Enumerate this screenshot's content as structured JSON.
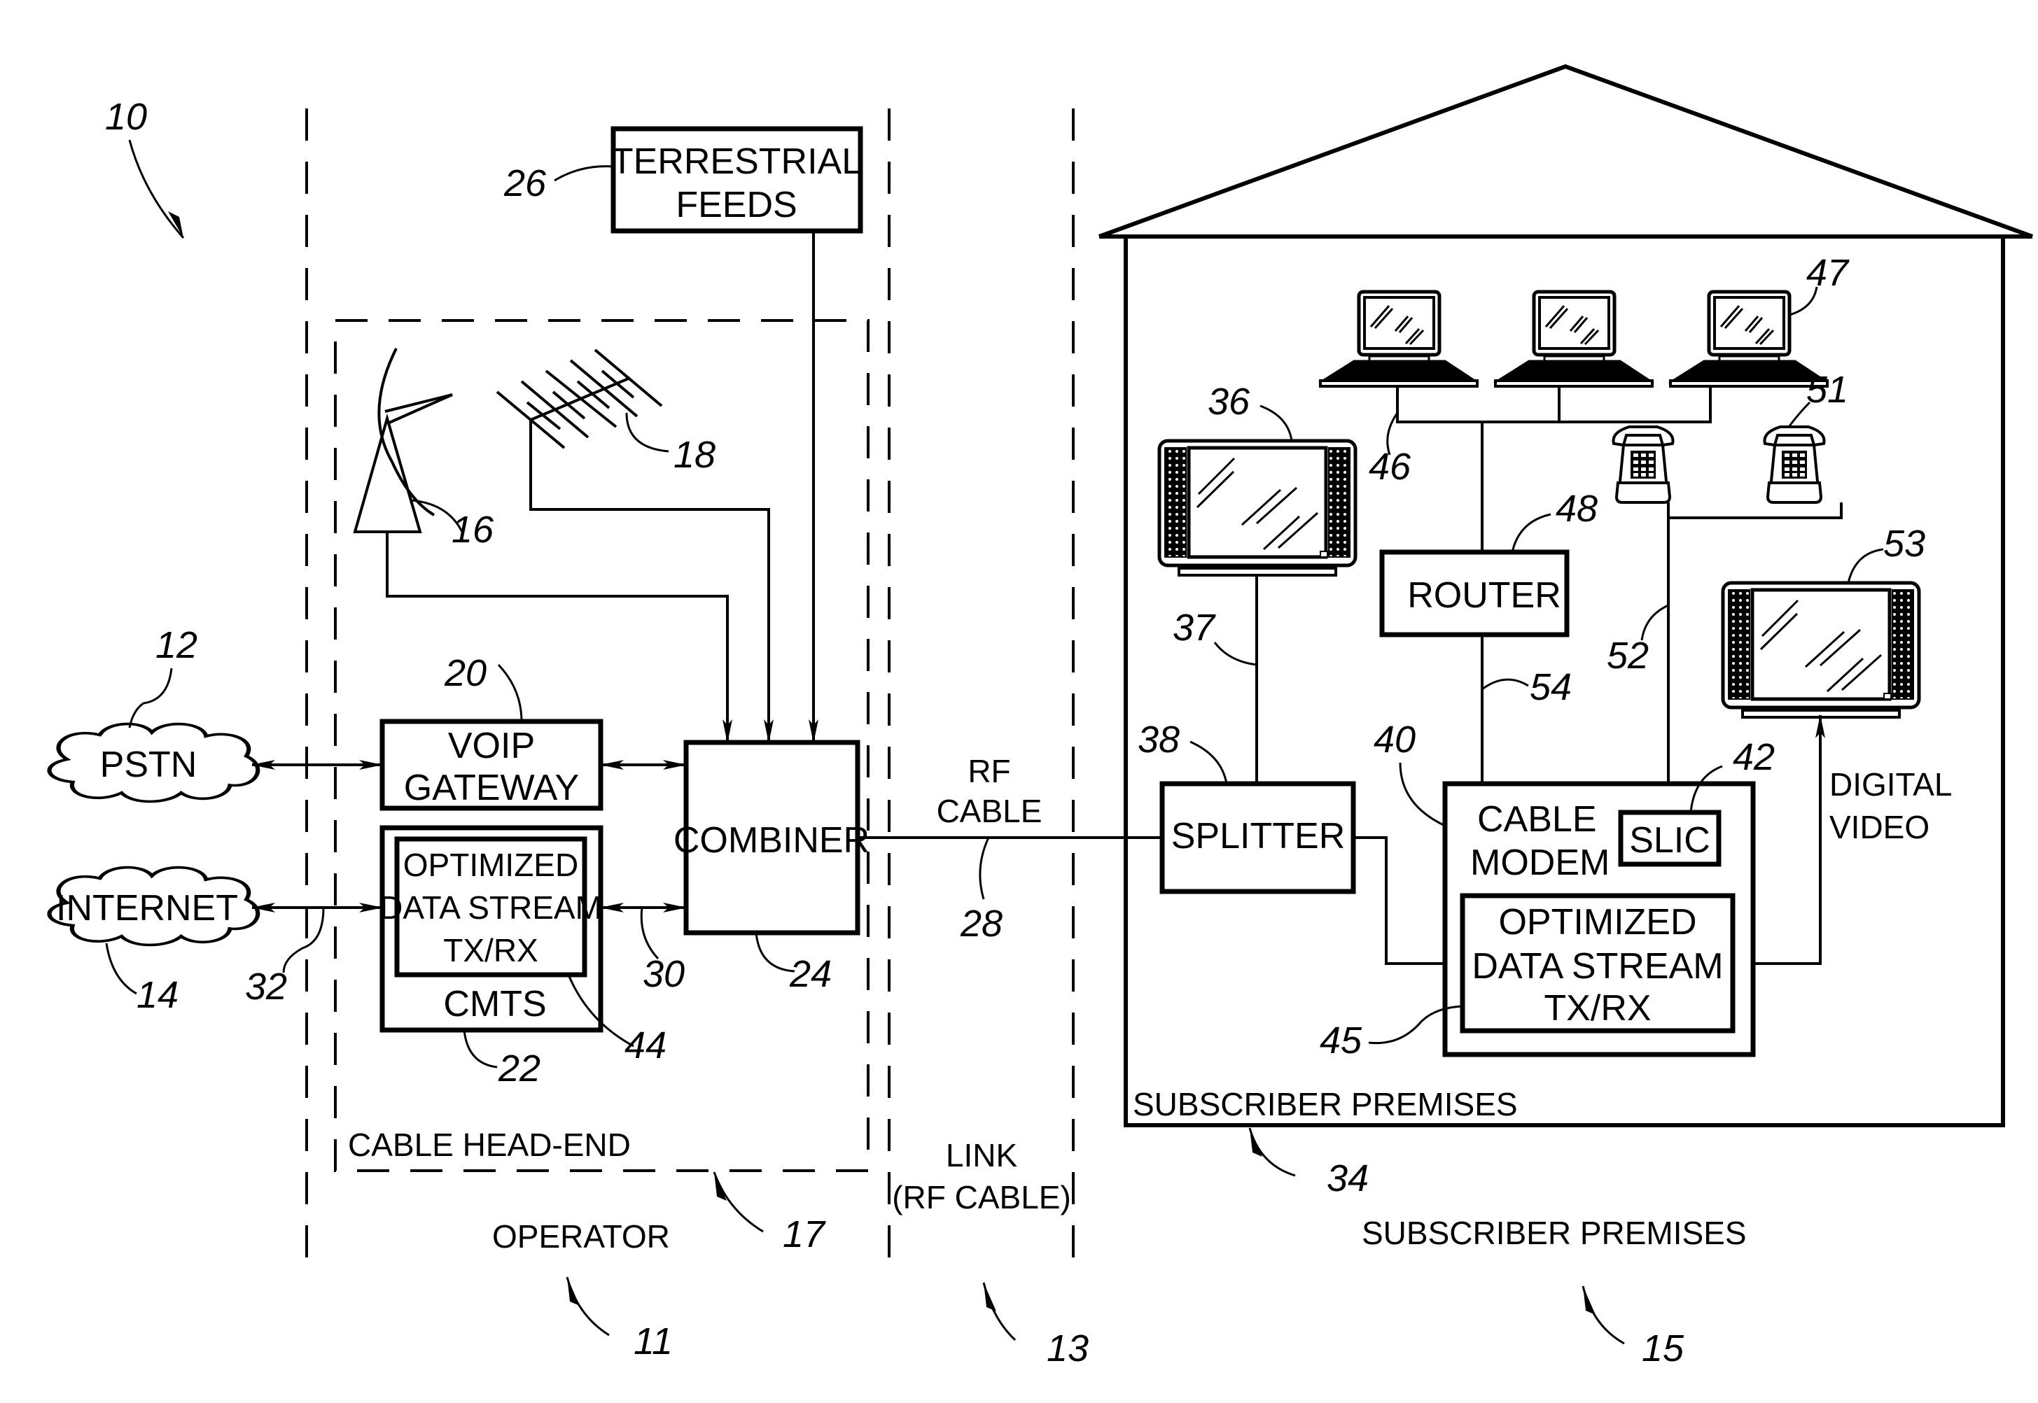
{
  "figure": {
    "ref_system": "10",
    "zones": {
      "operator": {
        "label": "OPERATOR",
        "ref": "11"
      },
      "link": {
        "label_line1": "LINK",
        "label_line2": "(RF CABLE)",
        "ref": "13"
      },
      "subscriber": {
        "label": "SUBSCRIBER PREMISES",
        "ref": "15"
      }
    },
    "headend": {
      "label": "CABLE HEAD-END",
      "ref": "17"
    },
    "clouds": {
      "pstn": {
        "label": "PSTN",
        "ref": "12"
      },
      "internet": {
        "label": "INTERNET",
        "ref": "14"
      }
    },
    "antennas": {
      "satellite_dish": {
        "ref": "16"
      },
      "yagi": {
        "ref": "18"
      }
    },
    "blocks": {
      "terrestrial": {
        "line1": "TERRESTRIAL",
        "line2": "FEEDS",
        "ref": "26"
      },
      "voip": {
        "line1": "VOIP",
        "line2": "GATEWAY",
        "ref": "20"
      },
      "cmts": {
        "label": "CMTS",
        "ref": "22"
      },
      "cmts_ods": {
        "line1": "OPTIMIZED",
        "line2": "DATA STREAM",
        "line3": "TX/RX",
        "ref": "44"
      },
      "combiner": {
        "label": "COMBINER",
        "ref": "24"
      },
      "splitter": {
        "label": "SPLITTER",
        "ref": "38"
      },
      "modem": {
        "line1": "CABLE",
        "line2": "MODEM",
        "ref": "40"
      },
      "slic": {
        "label": "SLIC",
        "ref": "42"
      },
      "modem_ods": {
        "line1": "OPTIMIZED",
        "line2": "DATA STREAM",
        "line3": "TX/RX",
        "ref": "45"
      },
      "router": {
        "label": "ROUTER",
        "ref": "48"
      }
    },
    "links": {
      "cmts_combiner": {
        "ref": "30"
      },
      "internet_cmts": {
        "ref": "32"
      },
      "rf_cable": {
        "line1": "RF",
        "line2": "CABLE",
        "ref": "28"
      },
      "tv_line": {
        "ref": "37"
      },
      "computer_bus": {
        "ref": "46"
      },
      "phone_line": {
        "ref": "52"
      },
      "router_line": {
        "ref": "54"
      },
      "digital_video": {
        "line1": "DIGITAL",
        "line2": "VIDEO"
      }
    },
    "devices": {
      "tv_left": {
        "ref": "36"
      },
      "tv_right": {
        "ref": "53"
      },
      "computers": {
        "ref": "47",
        "count": 3
      },
      "phones": {
        "ref": "51",
        "count": 2
      }
    },
    "house": {
      "label": "SUBSCRIBER PREMISES",
      "ref": "34"
    }
  }
}
